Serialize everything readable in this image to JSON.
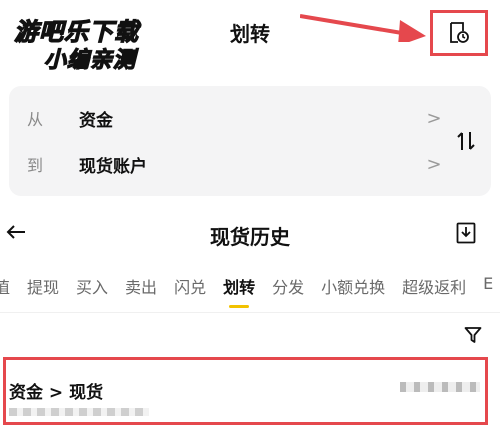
{
  "header": {
    "title": "划转"
  },
  "watermark": {
    "line1": "游吧乐下载",
    "line2": "小编亲测"
  },
  "transfer": {
    "from_label": "从",
    "from_value": "资金",
    "to_label": "到",
    "to_value": "现货账户"
  },
  "history": {
    "title": "现货历史",
    "tabs": [
      "值",
      "提现",
      "买入",
      "卖出",
      "闪兑",
      "划转",
      "分发",
      "小额兑换",
      "超级返利",
      "E"
    ],
    "active_tab": "划转",
    "record_title": "资金 > 现货"
  },
  "colors": {
    "highlight": "#e5484d",
    "active_indicator": "#f2c200",
    "card_bg": "#f4f4f5"
  },
  "icons": [
    "history-icon",
    "chevron-right-icon",
    "swap-icon",
    "back-arrow-icon",
    "download-icon",
    "filter-icon"
  ]
}
